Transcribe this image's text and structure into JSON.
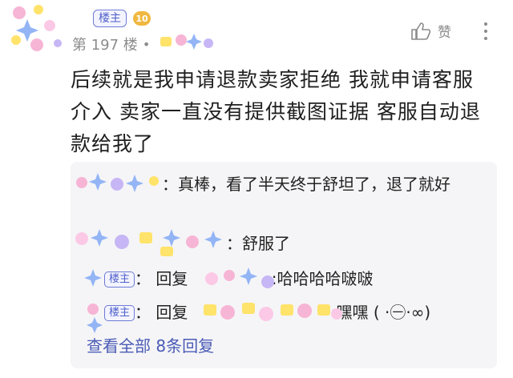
{
  "post": {
    "host_badge": "楼主",
    "level": "10",
    "floor": "第 197 楼",
    "floor_dot": "•",
    "like_label": "赞",
    "content": "后续就是我申请退款卖家拒绝 我就申请客服介入 卖家一直没有提供截图证据 客服自动退款给我了"
  },
  "replies": [
    {
      "sep": "：",
      "text": "真棒，看了半天终于舒坦了，退了就好"
    },
    {
      "sep": "：",
      "text": "舒服了"
    },
    {
      "badge": "楼主",
      "sep": "：",
      "reply_word": "回复",
      "text": ":哈哈哈哈啵啵"
    },
    {
      "badge": "楼主",
      "sep": "：",
      "reply_word": "回复",
      "text": ":嘿嘿 ( ·㊀·∞)"
    }
  ],
  "view_all": "查看全部 8条回复",
  "icons": [
    "thumbs-up-icon",
    "more-vertical-icon"
  ],
  "colors": {
    "accent": "#4a5bb5",
    "host_badge": "#6e7bd6",
    "level_badge": "#f0b840",
    "reply_bg": "#f5f5f7"
  }
}
